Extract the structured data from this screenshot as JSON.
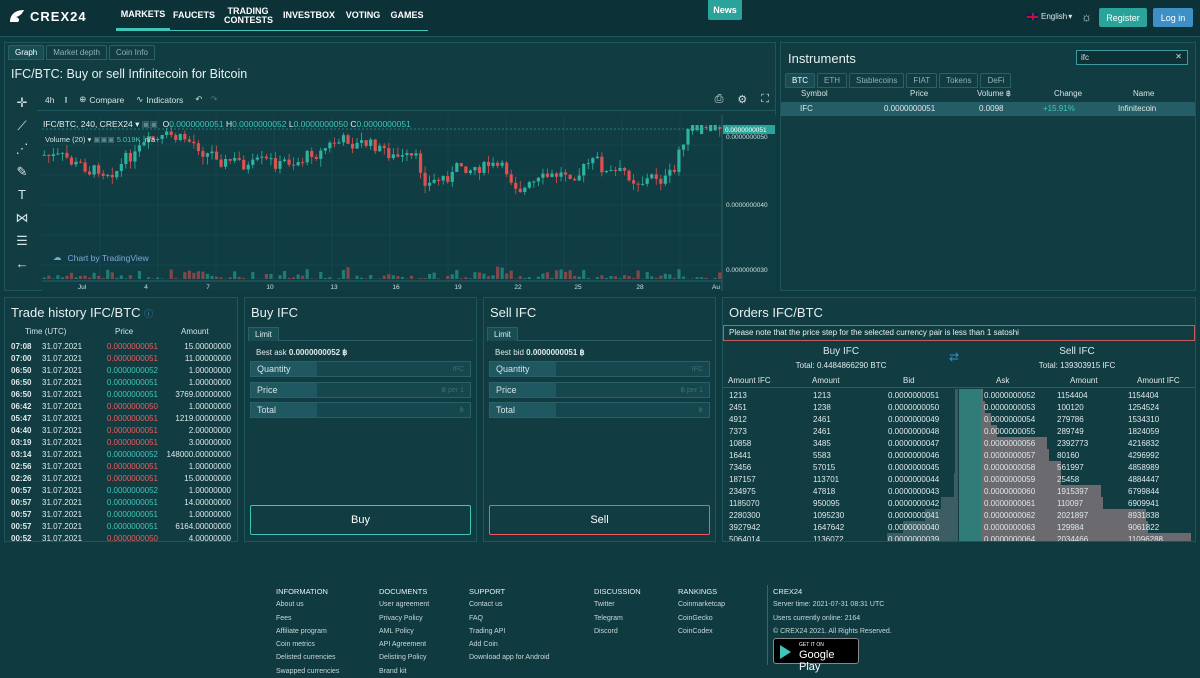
{
  "brand": "CREX24",
  "nav": [
    "MARKETS",
    "FAUCETS",
    "TRADING CONTESTS",
    "INVESTBOX",
    "VOTING",
    "GAMES"
  ],
  "news": "News",
  "lang": "English",
  "register": "Register",
  "login": "Log in",
  "chart_tabs": [
    "Graph",
    "Market depth",
    "Coin Info"
  ],
  "chart_title": "IFC/BTC: Buy or sell Infinitecoin for Bitcoin",
  "toolbar": {
    "interval": "4h",
    "compare": "Compare",
    "indicators": "Indicators"
  },
  "legend": {
    "symbol": "IFC/BTC, 240, CREX24",
    "o_label": "O",
    "o": "0.0000000051",
    "h_label": "H",
    "h": "0.0000000052",
    "l_label": "L",
    "l": "0.0000000050",
    "c_label": "C",
    "c": "0.0000000051",
    "volume": "Volume (20)",
    "vol_val": "5.019K",
    "na": "n/a"
  },
  "tv": "Chart by TradingView",
  "chart_data": {
    "type": "candlestick",
    "y_ticks": [
      "0.0000000051",
      "0.0000000050",
      "0.0000000040",
      "0.0000000030"
    ],
    "x_ticks": [
      "Jul",
      "4",
      "7",
      "10",
      "13",
      "16",
      "19",
      "22",
      "25",
      "28",
      "Au"
    ],
    "last_price": "0.0000000051"
  },
  "instruments": {
    "title": "Instruments",
    "search": "ifc",
    "tabs": [
      "BTC",
      "ETH",
      "Stablecoins",
      "FIAT",
      "Tokens",
      "DeFi"
    ],
    "cols": [
      "Symbol",
      "Price",
      "Volume ฿",
      "Change",
      "Name"
    ],
    "row": {
      "symbol": "IFC",
      "price": "0.0000000051",
      "volume": "0.0098",
      "change": "+15.91%",
      "name": "Infinitecoin"
    }
  },
  "trade_history": {
    "title": "Trade history IFC/BTC",
    "cols": [
      "Time (UTC)",
      "Price",
      "Amount"
    ],
    "rows": [
      [
        "07:08",
        "31.07.2021",
        "0.0000000051",
        "15.00000000",
        "r"
      ],
      [
        "07:00",
        "31.07.2021",
        "0.0000000051",
        "11.00000000",
        "r"
      ],
      [
        "06:50",
        "31.07.2021",
        "0.0000000052",
        "1.00000000",
        "g"
      ],
      [
        "06:50",
        "31.07.2021",
        "0.0000000051",
        "1.00000000",
        "g"
      ],
      [
        "06:50",
        "31.07.2021",
        "0.0000000051",
        "3769.00000000",
        "g"
      ],
      [
        "06:42",
        "31.07.2021",
        "0.0000000050",
        "1.00000000",
        "r"
      ],
      [
        "05:47",
        "31.07.2021",
        "0.0000000051",
        "1219.00000000",
        "r"
      ],
      [
        "04:40",
        "31.07.2021",
        "0.0000000051",
        "2.00000000",
        "r"
      ],
      [
        "03:19",
        "31.07.2021",
        "0.0000000051",
        "3.00000000",
        "r"
      ],
      [
        "03:14",
        "31.07.2021",
        "0.0000000052",
        "148000.00000000",
        "g"
      ],
      [
        "02:56",
        "31.07.2021",
        "0.0000000051",
        "1.00000000",
        "r"
      ],
      [
        "02:26",
        "31.07.2021",
        "0.0000000051",
        "15.00000000",
        "r"
      ],
      [
        "00:57",
        "31.07.2021",
        "0.0000000052",
        "1.00000000",
        "g"
      ],
      [
        "00:57",
        "31.07.2021",
        "0.0000000051",
        "14.00000000",
        "g"
      ],
      [
        "00:57",
        "31.07.2021",
        "0.0000000051",
        "1.00000000",
        "g"
      ],
      [
        "00:57",
        "31.07.2021",
        "0.0000000051",
        "6164.00000000",
        "g"
      ],
      [
        "00:52",
        "31.07.2021",
        "0.0000000050",
        "4.00000000",
        "r"
      ]
    ]
  },
  "buy": {
    "title": "Buy IFC",
    "tab": "Limit",
    "best_label": "Best ask",
    "best": "0.0000000052 ฿",
    "qty": "Quantity",
    "qty_ph": "IFC",
    "price": "Price",
    "price_ph": "฿ per 1",
    "total": "Total",
    "total_ph": "฿",
    "btn": "Buy"
  },
  "sell": {
    "title": "Sell IFC",
    "tab": "Limit",
    "best_label": "Best bid",
    "best": "0.0000000051 ฿",
    "qty": "Quantity",
    "qty_ph": "IFC",
    "price": "Price",
    "price_ph": "฿ per 1",
    "total": "Total",
    "total_ph": "฿",
    "btn": "Sell"
  },
  "orders": {
    "title": "Orders IFC/BTC",
    "note": "Please note that the price step for the selected currency pair is less than 1 satoshi",
    "buy_title": "Buy IFC",
    "buy_total": "Total: 0.4484866290 BTC",
    "sell_title": "Sell IFC",
    "sell_total": "Total: 139303915 IFC",
    "cols": [
      "Amount IFC",
      "Amount",
      "Bid",
      "Ask",
      "Amount",
      "Amount IFC"
    ],
    "bids": [
      [
        "1213",
        "1213",
        "0.0000000051"
      ],
      [
        "2451",
        "1238",
        "0.0000000050"
      ],
      [
        "4912",
        "2461",
        "0.0000000049"
      ],
      [
        "7373",
        "2461",
        "0.0000000048"
      ],
      [
        "10858",
        "3485",
        "0.0000000047"
      ],
      [
        "16441",
        "5583",
        "0.0000000046"
      ],
      [
        "73456",
        "57015",
        "0.0000000045"
      ],
      [
        "187157",
        "113701",
        "0.0000000044"
      ],
      [
        "234975",
        "47818",
        "0.0000000043"
      ],
      [
        "1185070",
        "950095",
        "0.0000000042"
      ],
      [
        "2280300",
        "1095230",
        "0.0000000041"
      ],
      [
        "3927942",
        "1647642",
        "0.0000000040"
      ],
      [
        "5064014",
        "1136072",
        "0.0000000039"
      ]
    ],
    "asks": [
      [
        "0.0000000052",
        "1154404",
        "1154404"
      ],
      [
        "0.0000000053",
        "100120",
        "1254524"
      ],
      [
        "0.0000000054",
        "279786",
        "1534310"
      ],
      [
        "0.0000000055",
        "289749",
        "1824059"
      ],
      [
        "0.0000000056",
        "2392773",
        "4216832"
      ],
      [
        "0.0000000057",
        "80160",
        "4296992"
      ],
      [
        "0.0000000058",
        "561997",
        "4858989"
      ],
      [
        "0.0000000059",
        "25458",
        "4884447"
      ],
      [
        "0.0000000060",
        "1915397",
        "6799844"
      ],
      [
        "0.0000000061",
        "110097",
        "6909941"
      ],
      [
        "0.0000000062",
        "2021897",
        "8931838"
      ],
      [
        "0.0000000063",
        "129984",
        "9061822"
      ],
      [
        "0.0000000064",
        "2034466",
        "11096288"
      ]
    ]
  },
  "footer": {
    "cols": [
      {
        "title": "INFORMATION",
        "items": [
          "About us",
          "Fees",
          "Affiliate program",
          "Coin metrics",
          "Delisted currencies",
          "Swapped currencies"
        ]
      },
      {
        "title": "DOCUMENTS",
        "items": [
          "User agreement",
          "Privacy Policy",
          "AML Policy",
          "API Agreement",
          "Delisting Policy",
          "Brand kit"
        ]
      },
      {
        "title": "SUPPORT",
        "items": [
          "Contact us",
          "FAQ",
          "Trading API",
          "Add Coin",
          "Download app for Android"
        ]
      },
      {
        "title": "DISCUSSION",
        "items": [
          "Twitter",
          "Telegram",
          "Discord"
        ]
      },
      {
        "title": "RANKINGS",
        "items": [
          "Coinmarketcap",
          "CoinGecko",
          "CoinCodex"
        ]
      },
      {
        "title": "CREX24",
        "items": [
          "Server time: 2021-07-31 08:31 UTC",
          "Users currently online: 2164",
          "© CREX24 2021. All Rights Reserved."
        ]
      }
    ],
    "gp_small": "GET IT ON",
    "gp": "Google Play"
  }
}
